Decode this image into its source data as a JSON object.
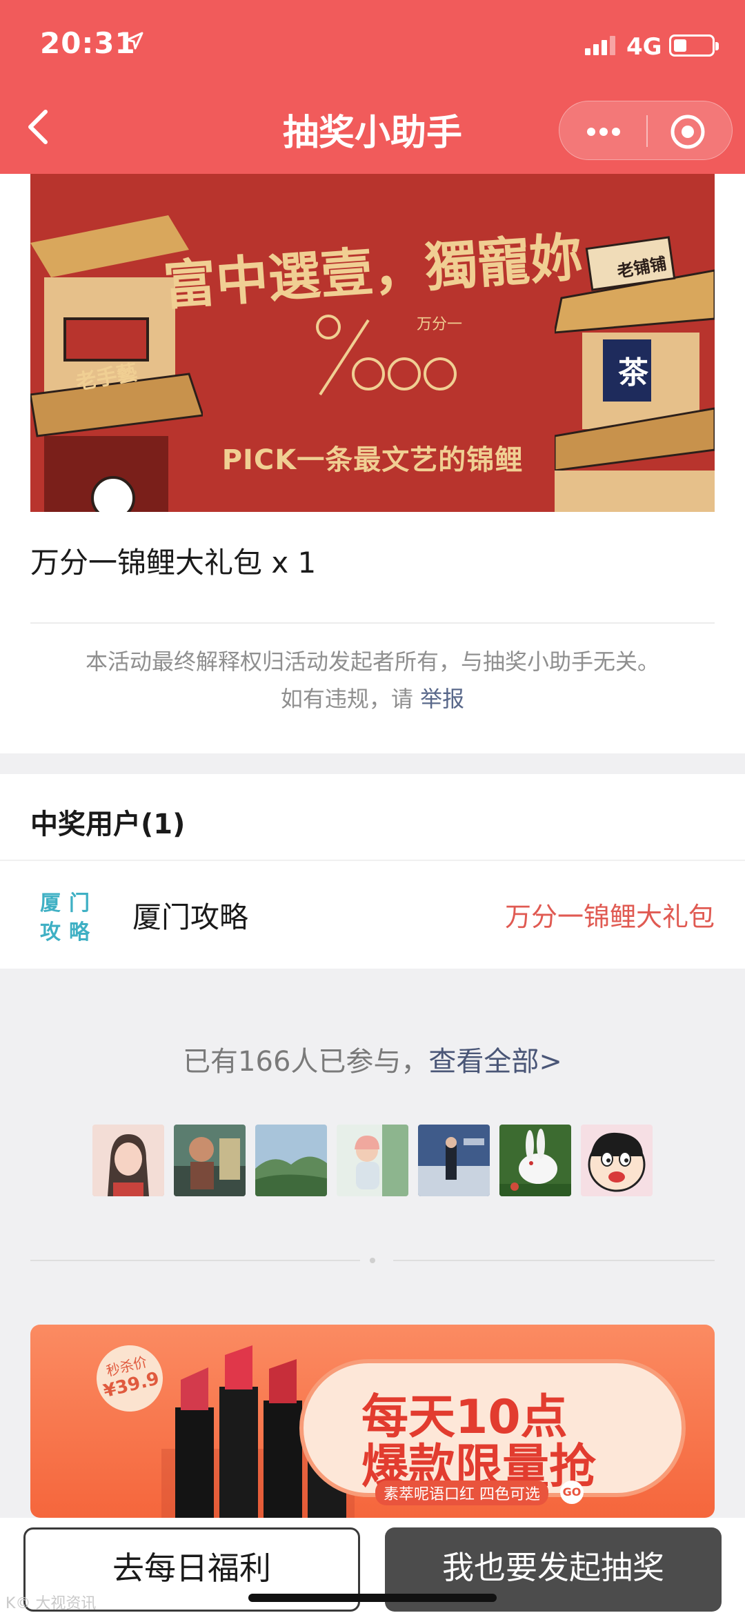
{
  "status_bar": {
    "time": "20:31",
    "network": "4G"
  },
  "nav": {
    "title": "抽奖小助手"
  },
  "banner": {
    "headline": "富中選壹，獨寵妳",
    "ratio_label": "万分一",
    "subline": "PICK一条最文艺的锦鲤",
    "left_shop_sign": "老手藝",
    "right_shop_sign": "老铺铺",
    "tea_char": "茶"
  },
  "prize": {
    "text": "万分一锦鲤大礼包 x 1"
  },
  "disclaimer": {
    "line1": "本活动最终解释权归活动发起者所有，与抽奖小助手无关。",
    "line2_prefix": "如有违规，请",
    "report_link": "举报"
  },
  "winners": {
    "title": "中奖用户(1)",
    "items": [
      {
        "avatar_text": [
          "厦",
          "门",
          "攻",
          "略"
        ],
        "name": "厦门攻略",
        "prize": "万分一锦鲤大礼包"
      }
    ]
  },
  "participants": {
    "text": "已有166人已参与，",
    "view_all": "查看全部>"
  },
  "ad": {
    "price_label": "秒杀价",
    "price_value": "¥39.9",
    "line1": "每天10点",
    "line2": "爆款限量抢",
    "small_text": "素萃呢语口红 四色可选",
    "go": "GO"
  },
  "buttons": {
    "welfare": "去每日福利",
    "launch": "我也要发起抽奖"
  },
  "watermark": "K© 大视资讯",
  "colors": {
    "nav_bg": "#f15b5b",
    "winner_prize": "#e05a52",
    "link": "#4a5677",
    "banner_bg": "#b8342d"
  }
}
